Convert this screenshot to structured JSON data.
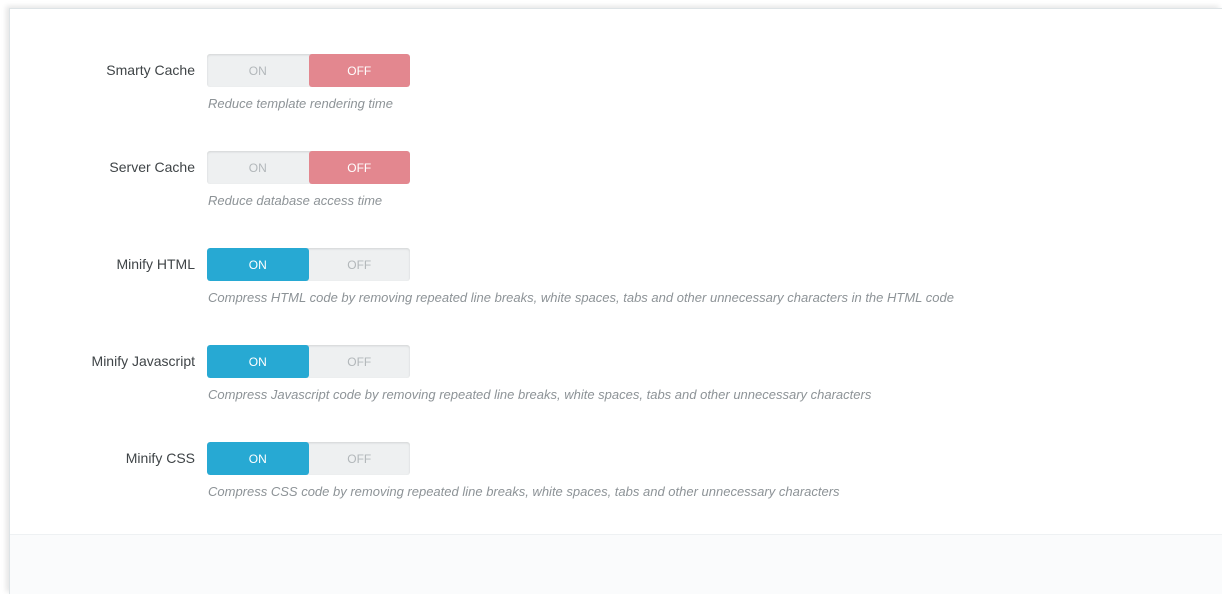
{
  "colors": {
    "off_active": "#e3878f",
    "on_active": "#27a9d3",
    "inactive_text": "#b2b7ba"
  },
  "settings": [
    {
      "label": "Smarty Cache",
      "on_label": "ON",
      "off_label": "OFF",
      "value": "OFF",
      "help": "Reduce template rendering time"
    },
    {
      "label": "Server Cache",
      "on_label": "ON",
      "off_label": "OFF",
      "value": "OFF",
      "help": "Reduce database access time"
    },
    {
      "label": "Minify HTML",
      "on_label": "ON",
      "off_label": "OFF",
      "value": "ON",
      "help": "Compress HTML code by removing repeated line breaks, white spaces, tabs and other unnecessary characters in the HTML code"
    },
    {
      "label": "Minify Javascript",
      "on_label": "ON",
      "off_label": "OFF",
      "value": "ON",
      "help": "Compress Javascript code by removing repeated line breaks, white spaces, tabs and other unnecessary characters"
    },
    {
      "label": "Minify CSS",
      "on_label": "ON",
      "off_label": "OFF",
      "value": "ON",
      "help": "Compress CSS code by removing repeated line breaks, white spaces, tabs and other unnecessary characters"
    }
  ]
}
